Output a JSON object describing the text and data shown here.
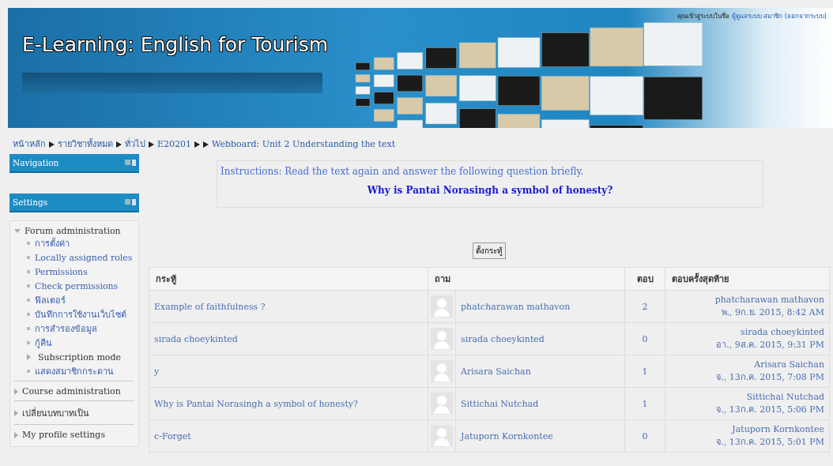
{
  "header": {
    "title": "E-Learning: English for Tourism",
    "login_text": "คุณเข้าสู่ระบบในชื่อ",
    "login_user": "ผู้ดูแลระบบ สมาชิก",
    "logout": "(ออกจากระบบ)"
  },
  "breadcrumb": [
    {
      "kind": "link",
      "label": "หน้าหลัก"
    },
    {
      "kind": "link",
      "label": "รายวิชาทั้งหมด"
    },
    {
      "kind": "link",
      "label": "ทั่วไป"
    },
    {
      "kind": "link",
      "label": "E20201"
    },
    {
      "kind": "blank"
    },
    {
      "kind": "link",
      "label": "Webboard: Unit 2 Understanding the text"
    }
  ],
  "blocks": [
    {
      "title": "Navigation"
    },
    {
      "title": "Settings"
    }
  ],
  "settings_tree": [
    {
      "label": "Forum administration",
      "expanded": true,
      "children": [
        {
          "label": "การตั้งค่า",
          "kind": "link"
        },
        {
          "label": "Locally assigned roles",
          "kind": "link"
        },
        {
          "label": "Permissions",
          "kind": "link"
        },
        {
          "label": "Check permissions",
          "kind": "link"
        },
        {
          "label": "ฟิลเตอร์",
          "kind": "link"
        },
        {
          "label": "บันทึกการใช้งานเว็บไซต์",
          "kind": "link"
        },
        {
          "label": "การสำรองข้อมูล",
          "kind": "link"
        },
        {
          "label": "กู้คืน",
          "kind": "link"
        },
        {
          "label": "Subscription mode",
          "kind": "branch"
        },
        {
          "label": "แสดงสมาชิกกระดาน",
          "kind": "link"
        }
      ]
    },
    {
      "label": "Course administration",
      "expanded": false
    },
    {
      "label": "เปลี่ยนบทบาทเป็น",
      "expanded": false
    },
    {
      "label": "My profile settings",
      "expanded": false
    }
  ],
  "intro": {
    "instructions": "Instructions: Read the text again and answer the following question briefly.",
    "question": "Why is Pantai Norasingh a symbol of honesty?"
  },
  "new_topic_button": "ตั้งกระทู้",
  "table": {
    "columns": [
      "กระทู้",
      "ถาม",
      "ตอบ",
      "ตอบครั้งสุดท้าย"
    ],
    "rows": [
      {
        "topic": "Example of faithfulness ?",
        "author": "phatcharawan mathavon",
        "replies": "2",
        "last_user": "phatcharawan mathavon",
        "last_date": "พ., 9ก.ย. 2015, 8:42 AM"
      },
      {
        "topic": "sirada choeykinted",
        "author": "sirada choeykinted",
        "replies": "0",
        "last_user": "sirada choeykinted",
        "last_date": "อา., 9ส.ค. 2015, 9:31 PM"
      },
      {
        "topic": "y",
        "author": "Arisara Saichan",
        "replies": "1",
        "last_user": "Arisara Saichan",
        "last_date": "จ., 13ก.ค. 2015, 7:08 PM"
      },
      {
        "topic": "Why is Pantai Norasingh a symbol of honesty?",
        "author": "Sittichai Nutchad",
        "replies": "1",
        "last_user": "Sittichai Nutchad",
        "last_date": "จ., 13ก.ค. 2015, 5:06 PM"
      },
      {
        "topic": "c-Forget",
        "author": "Jatuporn Kornkontee",
        "replies": "0",
        "last_user": "Jatuporn Kornkontee",
        "last_date": "จ., 13ก.ค. 2015, 5:01 PM"
      }
    ]
  }
}
